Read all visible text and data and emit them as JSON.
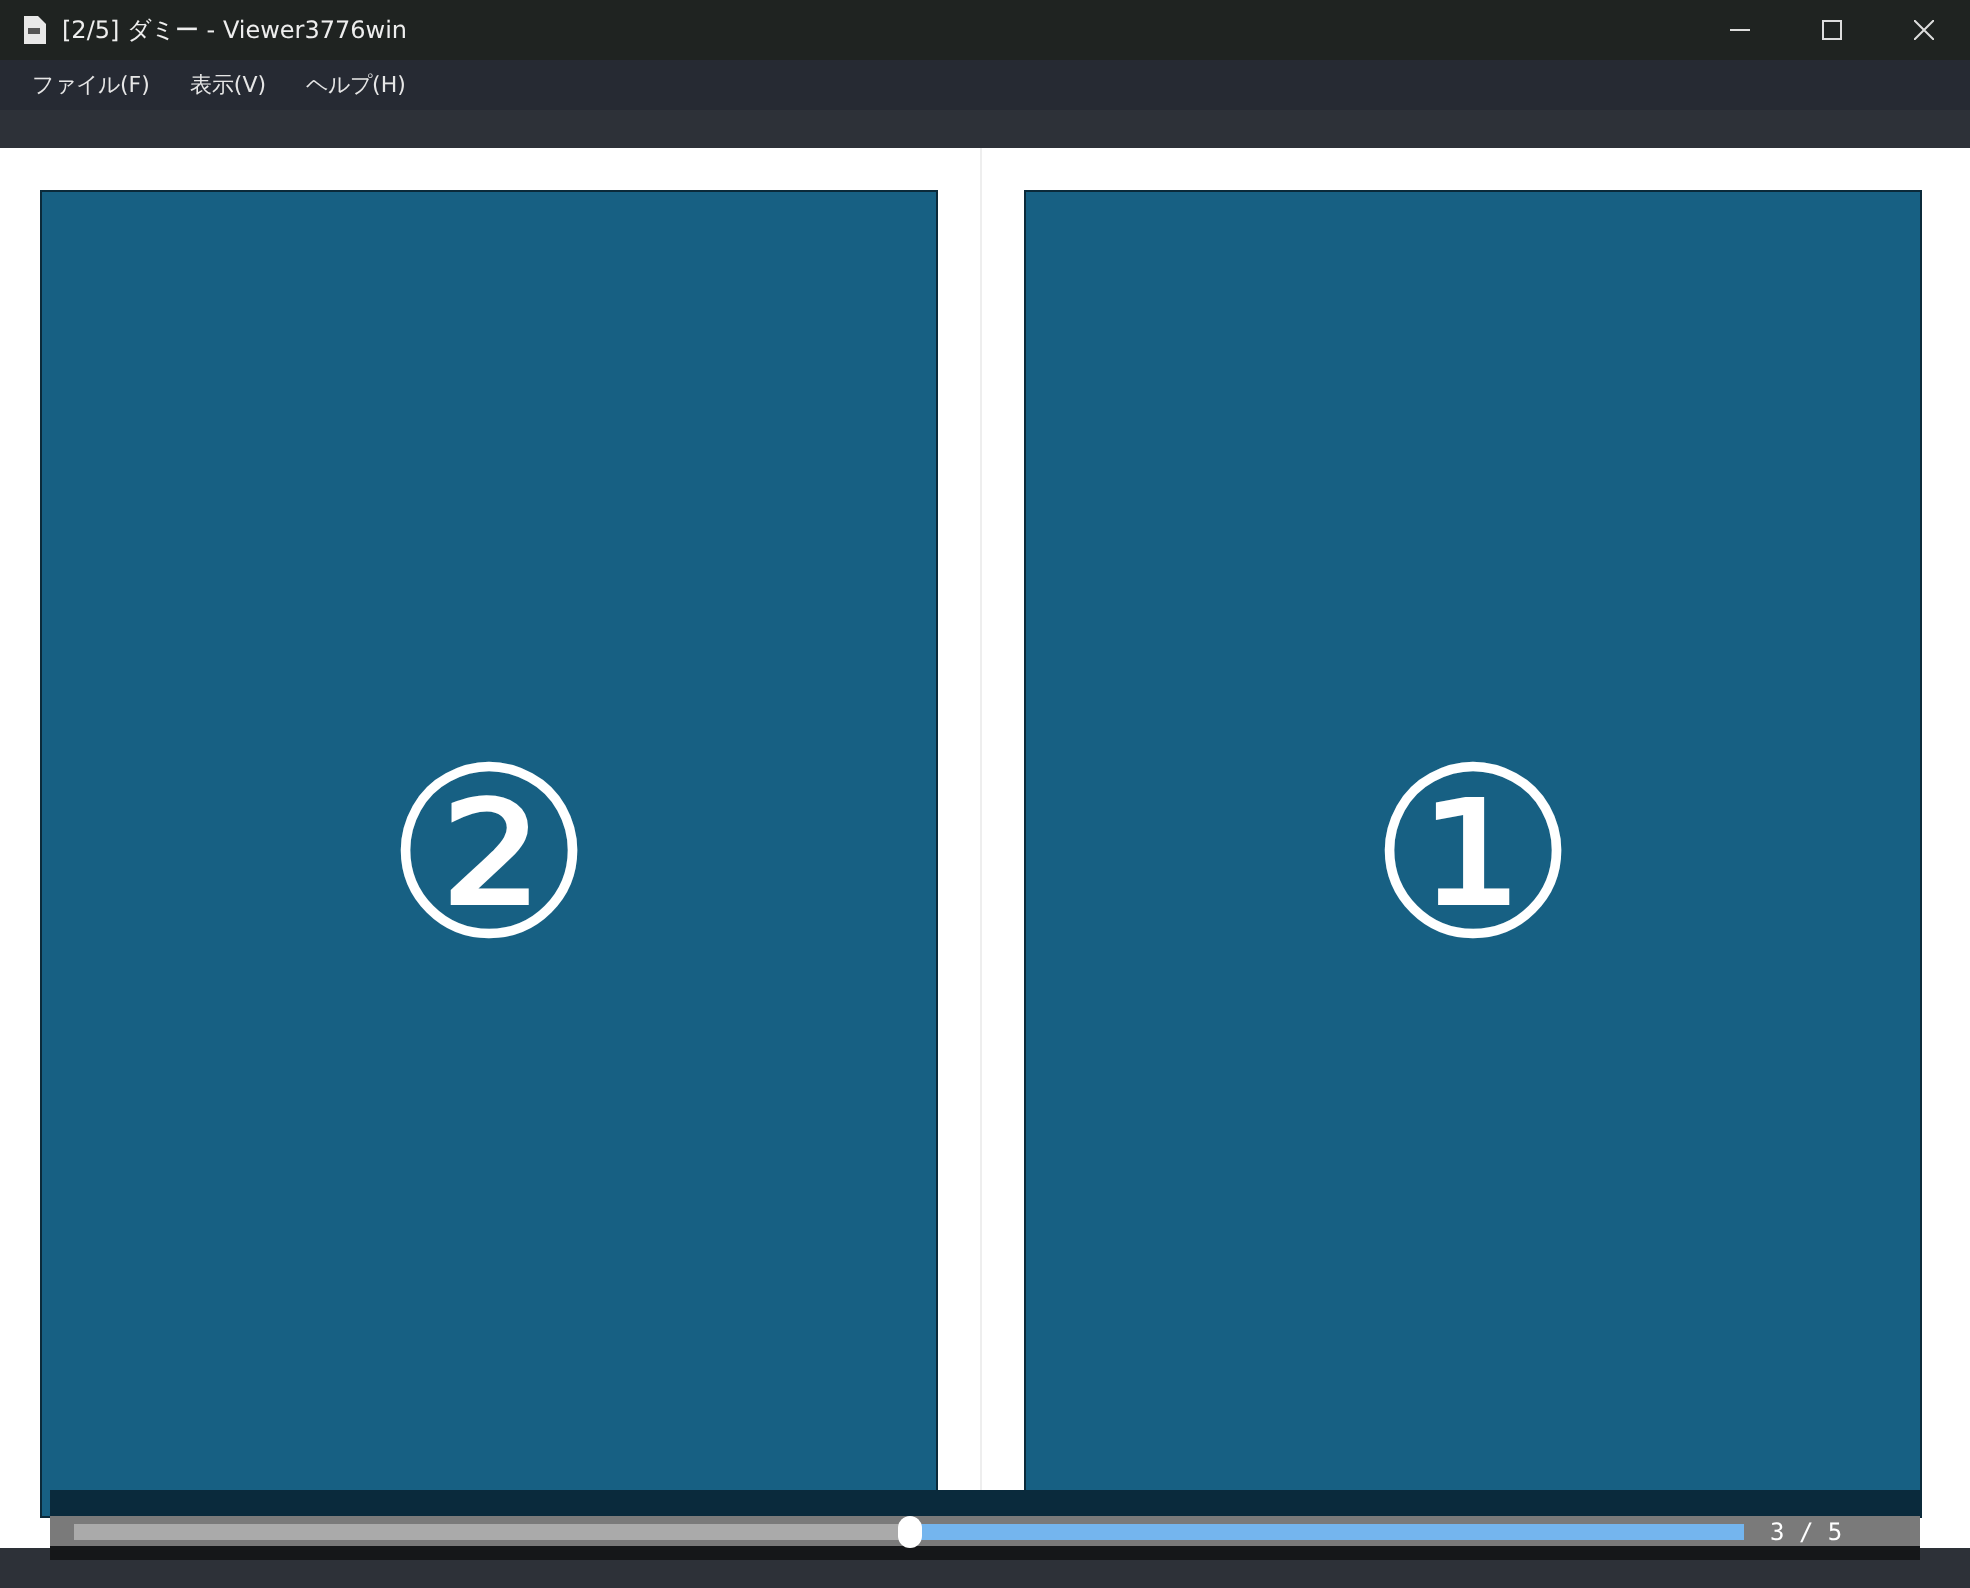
{
  "window": {
    "title": "[2/5] ダミー - Viewer3776win"
  },
  "menu": [
    "ファイル(F)",
    "表示(V)",
    "ヘルプ(H)"
  ],
  "pages": [
    {
      "label": "②"
    },
    {
      "label": "①"
    }
  ],
  "slider": {
    "level": 0.5,
    "reading": "3 / 5"
  }
}
